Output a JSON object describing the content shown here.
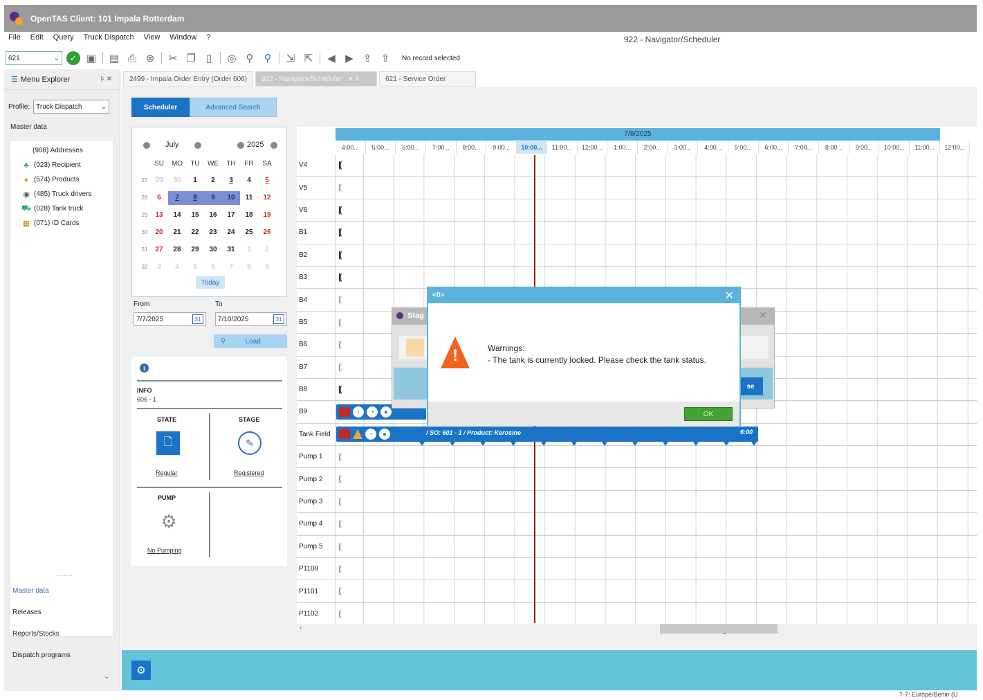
{
  "window": {
    "title": "OpenTAS  Client: 101 Impala Rotterdam",
    "doc_title": "922 - Navigator/Scheduler"
  },
  "menu": [
    "File",
    "Edit",
    "Query",
    "Truck Dispatch",
    "View",
    "Window",
    "?"
  ],
  "toolbar": {
    "record_combo": "621",
    "status_text": "No record selected"
  },
  "left": {
    "header": "Menu Explorer",
    "profile_label": "Profile:",
    "profile_value": "Truck Dispatch",
    "master_data_label": "Master data",
    "tree": [
      {
        "icon": "addresses",
        "label": "(908) Addresses"
      },
      {
        "icon": "recipient-icon",
        "label": "(023) Recipient"
      },
      {
        "icon": "products-icon",
        "label": "(574) Products"
      },
      {
        "icon": "truck-drivers-icon",
        "label": "(485) Truck drivers"
      },
      {
        "icon": "tank-truck-icon",
        "label": "(028) Tank truck"
      },
      {
        "icon": "id-cards-icon",
        "label": "(071) ID Cards"
      }
    ],
    "nav": [
      "Master data",
      "Releases",
      "Reports/Stocks",
      "Dispatch programs"
    ]
  },
  "tabs": [
    {
      "label": "2499 - Impala Order Entry (Order 606)"
    },
    {
      "label": "922 - Navigator/Scheduler"
    },
    {
      "label": "621 - Service Order"
    }
  ],
  "scheduler_tabs": {
    "scheduler": "Scheduler",
    "advanced": "Advanced Search"
  },
  "calendar": {
    "month": "July",
    "year": "2025",
    "weekdays": [
      "SU",
      "MO",
      "TU",
      "WE",
      "TH",
      "FR",
      "SA"
    ],
    "weeks": [
      {
        "wk": "27",
        "days": [
          "29",
          "30",
          "1",
          "2",
          "3",
          "4",
          "5"
        ]
      },
      {
        "wk": "28",
        "days": [
          "6",
          "7",
          "8",
          "9",
          "10",
          "11",
          "12"
        ]
      },
      {
        "wk": "29",
        "days": [
          "13",
          "14",
          "15",
          "16",
          "17",
          "18",
          "19"
        ]
      },
      {
        "wk": "30",
        "days": [
          "20",
          "21",
          "22",
          "23",
          "24",
          "25",
          "26"
        ]
      },
      {
        "wk": "31",
        "days": [
          "27",
          "28",
          "29",
          "30",
          "31",
          "1",
          "2"
        ]
      },
      {
        "wk": "32",
        "days": [
          "3",
          "4",
          "5",
          "6",
          "7",
          "8",
          "9"
        ]
      }
    ],
    "today_label": "Today"
  },
  "range": {
    "from_label": "From",
    "from_value": "7/7/2025",
    "to_label": "To",
    "to_value": "7/10/2025",
    "load_label": "Load"
  },
  "info": {
    "info_label": "INFO",
    "info_value": "606 - 1",
    "state_label": "STATE",
    "state_value": "Regular",
    "stage_label": "STAGE",
    "stage_value": "Registered",
    "pump_label": "PUMP",
    "pump_value": "No Pumping"
  },
  "scheduler": {
    "date": "7/8/2025",
    "hours": [
      "4:00...",
      "5:00...",
      "6:00...",
      "7:00...",
      "8:00...",
      "9:00...",
      "10:00...",
      "11:00...",
      "12:00...",
      "1:00...",
      "2:00...",
      "3:00...",
      "4:00...",
      "5:00...",
      "6:00...",
      "7:00...",
      "8:00...",
      "9:00...",
      "10:00...",
      "11:00...",
      "12:00...",
      "1:"
    ],
    "rows": [
      "V4",
      "V5",
      "V6",
      "B1",
      "B2",
      "B3",
      "B4",
      "B5",
      "B6",
      "B7",
      "B8",
      "B9",
      "Tank Field",
      "Pump 1",
      "Pump 2",
      "Pump 3",
      "Pump 4",
      "Pump 5",
      "P1108",
      "P1101",
      "P1102"
    ],
    "tank_bar_text": "/ SO: 601 - 1 / Product: Kerosine",
    "tank_bar_end": "6:00"
  },
  "stage_dialog": {
    "title": "Stag",
    "button": "se"
  },
  "modal": {
    "title": "<0>",
    "line1": "Warnings:",
    "line2": "- The tank is currently locked. Please check the tank status.",
    "ok": "OK"
  },
  "status_bar": "T-7: Europe/Berlin (U"
}
